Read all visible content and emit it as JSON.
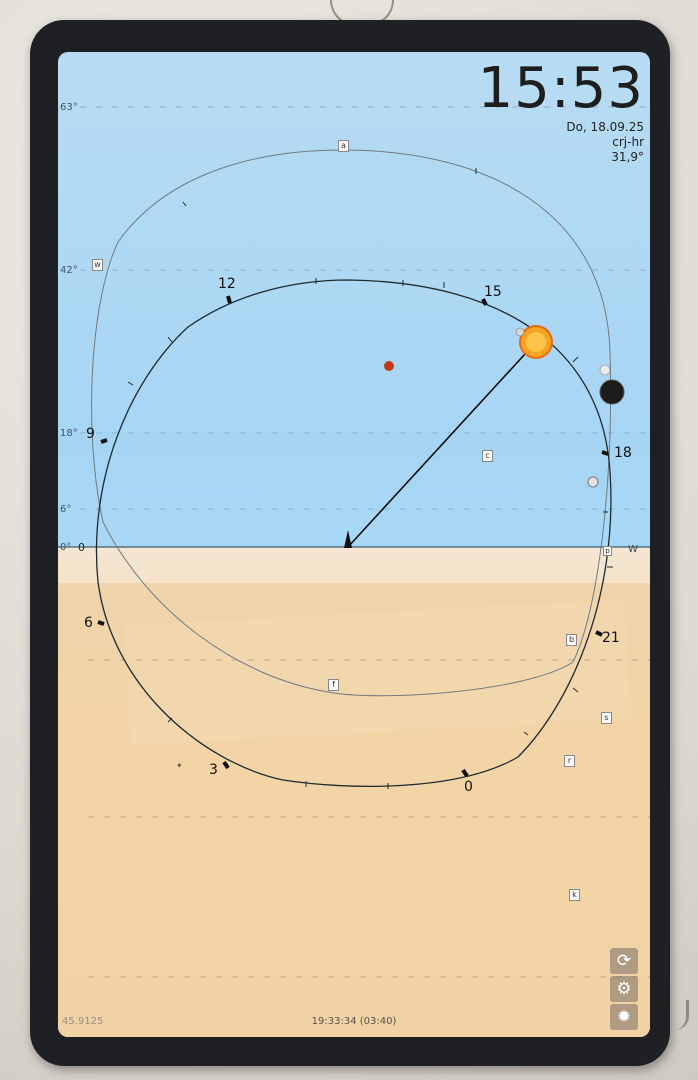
{
  "clock": {
    "time": "15:53",
    "date": "Do, 18.09.25",
    "location": "crj-hr",
    "temperature": "31,9°"
  },
  "elevation_labels": [
    "63°",
    "42°",
    "18°",
    "6°",
    "0°"
  ],
  "hour_labels": {
    "h0": "0",
    "h3": "3",
    "h6": "6",
    "h9": "9",
    "h12": "12",
    "h15": "15",
    "h18": "18",
    "h21": "21"
  },
  "horizon_label_zero": "0",
  "direction_label": "W",
  "markers": [
    "a",
    "w",
    "c",
    "b",
    "f",
    "s",
    "r",
    "k",
    "p"
  ],
  "status": {
    "center": "19:33:34 (03:40)",
    "left": "45.9125"
  },
  "buttons": {
    "refresh_icon": "refresh-icon",
    "settings_icon": "gear-icon",
    "brightness_icon": "sun-icon"
  },
  "colors": {
    "sky": "#a8d7f6",
    "ground": "#f2d3a6",
    "sun": "#f2a21a",
    "moon": "#222222",
    "planet": "#c0391b"
  }
}
